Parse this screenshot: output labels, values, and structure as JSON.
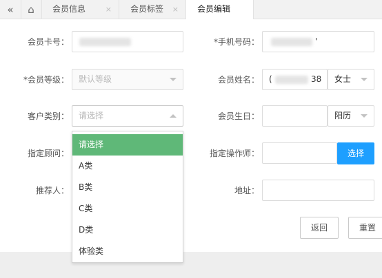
{
  "tabs": [
    {
      "label": "会员信息",
      "close": "×"
    },
    {
      "label": "会员标签",
      "close": "×"
    },
    {
      "label": "会员编辑",
      "close": ""
    }
  ],
  "icons": {
    "back": "«",
    "home": "⌂"
  },
  "form": {
    "card_no_label": "会员卡号：",
    "phone_label": "*手机号码：",
    "phone_tail": "'",
    "level_label": "*会员等级：",
    "level_placeholder": "默认等级",
    "name_label": "会员姓名：",
    "name_prefix": "(",
    "name_suffix": "38",
    "gender": "女士",
    "type_label": "客户类别：",
    "type_placeholder": "请选择",
    "birthday_label": "会员生日：",
    "calendar": "阳历",
    "advisor_label": "指定顾问：",
    "operator_label": "指定操作师：",
    "select_button": "选择",
    "referrer_label": "推荐人：",
    "address_label": "地址：",
    "back_button": "返回",
    "reset_button": "重置"
  },
  "dropdown": {
    "options": [
      "请选择",
      "A类",
      "B类",
      "C类",
      "D类",
      "体验类"
    ],
    "selected": "请选择"
  },
  "colors": {
    "selected_option": "#5fb878",
    "primary_button": "#1e9fff"
  }
}
